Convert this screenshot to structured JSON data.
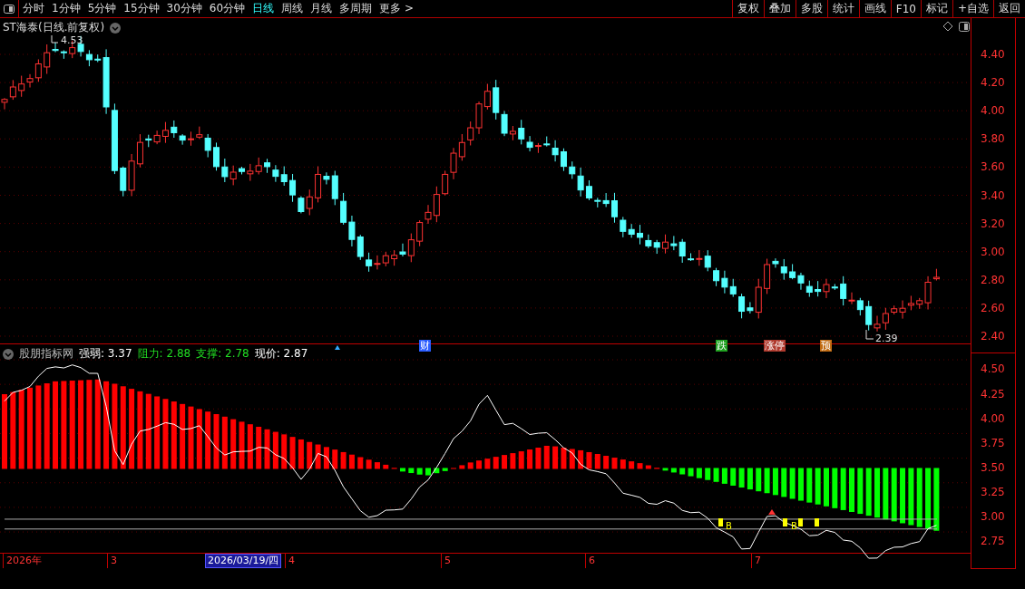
{
  "toolbar": {
    "periods": [
      {
        "label": "分时",
        "selected": false
      },
      {
        "label": "1分钟",
        "selected": false
      },
      {
        "label": "5分钟",
        "selected": false
      },
      {
        "label": "15分钟",
        "selected": false
      },
      {
        "label": "30分钟",
        "selected": false
      },
      {
        "label": "60分钟",
        "selected": false
      },
      {
        "label": "日线",
        "selected": true
      },
      {
        "label": "周线",
        "selected": false
      },
      {
        "label": "月线",
        "selected": false
      },
      {
        "label": "多周期",
        "selected": false
      },
      {
        "label": "更多 >",
        "selected": false
      }
    ],
    "buttons": [
      "复权",
      "叠加",
      "多股",
      "统计",
      "画线",
      "F10",
      "标记",
      "+自选",
      "返回"
    ]
  },
  "main_chart": {
    "title": "ST海泰(日线.前复权)",
    "high_label": "4.53",
    "low_label": "2.39",
    "yticks": [
      "4.40",
      "4.20",
      "4.00",
      "3.80",
      "3.60",
      "3.40",
      "3.20",
      "3.00",
      "2.80",
      "2.60",
      "2.40"
    ],
    "event_marks": [
      {
        "label": "财",
        "color": "#2a5cff"
      },
      {
        "label": "跌",
        "color": "#1fa01f"
      },
      {
        "label": "涨停",
        "color": "#b03a2e"
      },
      {
        "label": "预",
        "color": "#c06a10"
      }
    ]
  },
  "indicator": {
    "name": "股朋指标网",
    "readings": [
      {
        "label": "强弱: 3.37",
        "color": "#ffffff"
      },
      {
        "label": "阻力: 2.88",
        "color": "#22dd22"
      },
      {
        "label": "支撑: 2.78",
        "color": "#22dd22"
      },
      {
        "label": "现价: 2.87",
        "color": "#ffffff"
      }
    ],
    "yticks": [
      "4.50",
      "4.25",
      "4.00",
      "3.75",
      "3.50",
      "3.25",
      "3.00",
      "2.75"
    ],
    "signals": [
      "B",
      "B"
    ]
  },
  "date_axis": [
    {
      "label": "2026年",
      "selected": false
    },
    {
      "label": "3",
      "selected": false
    },
    {
      "label": "2026/03/19/四",
      "selected": true
    },
    {
      "label": "4",
      "selected": false
    },
    {
      "label": "5",
      "selected": false
    },
    {
      "label": "6",
      "selected": false
    },
    {
      "label": "7",
      "selected": false
    }
  ]
}
